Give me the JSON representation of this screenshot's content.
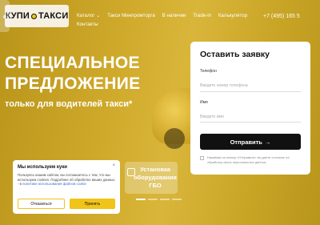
{
  "logo": {
    "left": "КУПИ",
    "right": "ТАКСИ"
  },
  "nav": {
    "items": [
      "Каталог",
      "Такси Минпромторга",
      "В наличии",
      "Trade-in",
      "Калькулятор",
      "Контакты"
    ],
    "catalog_chevron": "⌄"
  },
  "phone": "+7 (495) 165 5",
  "hero": {
    "title_line1": "СПЕЦИАЛЬНОЕ",
    "title_line2": "ПРЕДЛОЖЕНИЕ",
    "subtitle": "только для водителей такси*"
  },
  "form": {
    "title": "Оставить заявку",
    "phone_label": "Телефон",
    "phone_placeholder": "Введите номер телефона",
    "name_label": "Имя",
    "name_placeholder": "Введите имя",
    "submit_label": "Отправить",
    "submit_arrow": "→",
    "consent_text": "Нажимая на кнопку «Отправить» вы даете согласие на обработку своих персональных данных"
  },
  "cards": {
    "card1_text": "е",
    "card2_line1": "Установка",
    "card2_line2": "оборудования",
    "card2_line3": "ГБО"
  },
  "slider": {
    "total": 4,
    "active": 0
  },
  "cookie": {
    "title": "Мы используем куки",
    "close": "×",
    "text": "Пользуясь нашим сайтом, вы соглашаетесь с тем, что мы используем cookies. Подробнее об обработке ваших данных - в ",
    "link": "политике использования файлов cookie",
    "decline_label": "Отказаться",
    "accept_label": "Принять"
  },
  "colors": {
    "brand_yellow": "#f0c419",
    "dark": "#111111"
  }
}
